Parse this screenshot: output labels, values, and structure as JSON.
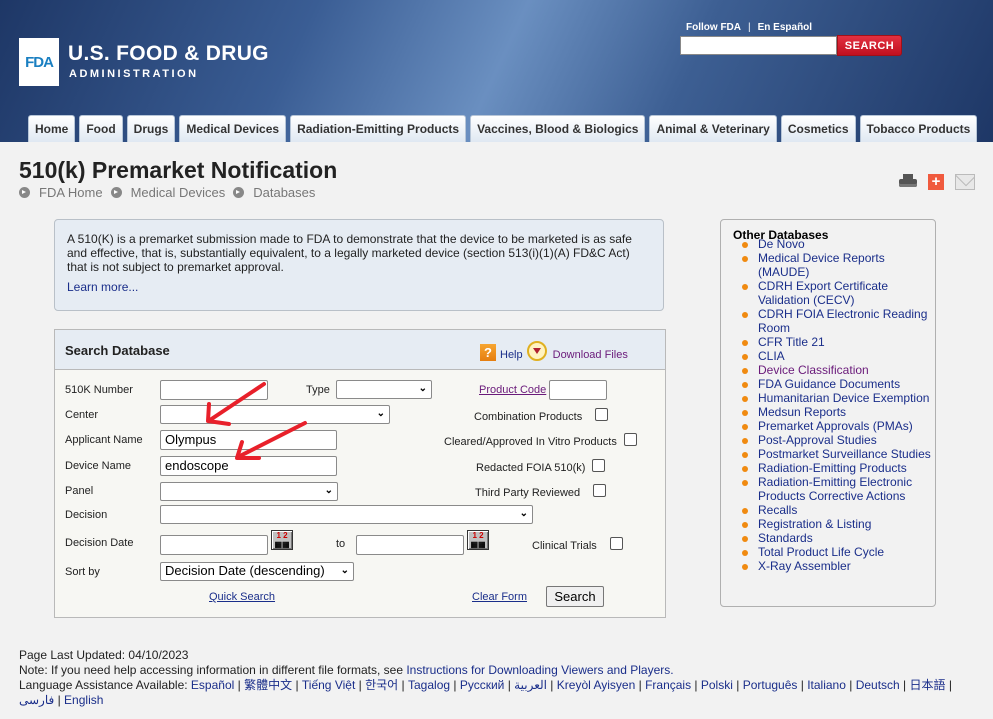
{
  "header": {
    "logo_text": "FDA",
    "agency_line1": "U.S. FOOD & DRUG",
    "agency_line2": "ADMINISTRATION",
    "top_links": [
      "Follow FDA",
      "En Español"
    ],
    "top_links_separator": "|",
    "search_placeholder": "",
    "search_button": "SEARCH",
    "nav_tabs": [
      "Home",
      "Food",
      "Drugs",
      "Medical Devices",
      "Radiation-Emitting Products",
      "Vaccines, Blood & Biologics",
      "Animal & Veterinary",
      "Cosmetics",
      "Tobacco Products"
    ]
  },
  "page": {
    "title": "510(k) Premarket Notification",
    "breadcrumb": [
      "FDA Home",
      "Medical Devices",
      "Databases"
    ],
    "tools": {
      "print_icon": "printer-icon",
      "share_icon": "plus-icon",
      "email_icon": "mail-icon"
    }
  },
  "info": {
    "text": "A 510(K) is a premarket submission made to FDA to demonstrate that the device to be marketed is as safe and effective, that is, substantially equivalent, to a legally marketed device (section 513(i)(1)(A) FD&C Act) that is not subject to premarket approval.",
    "learn_more": "Learn more..."
  },
  "search_panel": {
    "title": "Search Database",
    "help": "Help",
    "download": "Download Files",
    "fields": {
      "k_number": {
        "label": "510K Number",
        "value": ""
      },
      "type": {
        "label": "Type",
        "value": ""
      },
      "product_code": {
        "label": "Product Code",
        "value": ""
      },
      "center": {
        "label": "Center",
        "value": ""
      },
      "applicant": {
        "label": "Applicant Name",
        "value": "Olympus"
      },
      "device": {
        "label": "Device Name",
        "value": "endoscope"
      },
      "panel": {
        "label": "Panel",
        "value": ""
      },
      "decision": {
        "label": "Decision",
        "value": ""
      },
      "decision_date": {
        "label": "Decision Date",
        "from": "",
        "to": "",
        "to_label": "to"
      },
      "sort_by": {
        "label": "Sort by",
        "value": "Decision Date (descending)"
      }
    },
    "checkboxes": {
      "combination": {
        "label": "Combination Products",
        "checked": false
      },
      "in_vitro": {
        "label": "Cleared/Approved In Vitro Products",
        "checked": false
      },
      "redacted": {
        "label": "Redacted FOIA 510(k)",
        "checked": false
      },
      "third_party": {
        "label": "Third Party Reviewed",
        "checked": false
      },
      "clinical": {
        "label": "Clinical Trials",
        "checked": false
      }
    },
    "quick_search": "Quick Search",
    "clear_form": "Clear Form",
    "search_button": "Search",
    "annotation_color": "#e8202a"
  },
  "sidebar": {
    "title": "Other Databases",
    "items": [
      {
        "label": "De Novo",
        "visited": false
      },
      {
        "label": "Medical Device Reports (MAUDE)",
        "visited": false
      },
      {
        "label": "CDRH Export Certificate Validation (CECV)",
        "visited": false
      },
      {
        "label": "CDRH FOIA Electronic Reading Room",
        "visited": false
      },
      {
        "label": "CFR Title 21",
        "visited": false
      },
      {
        "label": "CLIA",
        "visited": false
      },
      {
        "label": "Device Classification",
        "visited": true
      },
      {
        "label": "FDA Guidance Documents",
        "visited": false
      },
      {
        "label": "Humanitarian Device Exemption",
        "visited": false
      },
      {
        "label": "Medsun Reports",
        "visited": false
      },
      {
        "label": "Premarket Approvals (PMAs)",
        "visited": false
      },
      {
        "label": "Post-Approval Studies",
        "visited": false
      },
      {
        "label": "Postmarket Surveillance Studies",
        "visited": false
      },
      {
        "label": "Radiation-Emitting Products",
        "visited": false
      },
      {
        "label": "Radiation-Emitting Electronic Products Corrective Actions",
        "visited": false
      },
      {
        "label": "Recalls",
        "visited": false
      },
      {
        "label": "Registration & Listing",
        "visited": false
      },
      {
        "label": "Standards",
        "visited": false
      },
      {
        "label": "Total Product Life Cycle",
        "visited": false
      },
      {
        "label": "X-Ray Assembler",
        "visited": false
      }
    ]
  },
  "footer": {
    "last_updated": "Page Last Updated: 04/10/2023",
    "note_prefix": "Note: If you need help accessing information in different file formats, see ",
    "note_link": "Instructions for Downloading Viewers and Players.",
    "lang_prefix": "Language Assistance Available: ",
    "languages": [
      "Español",
      "繁體中文",
      "Tiếng Việt",
      "한국어",
      "Tagalog",
      "Русский",
      "العربية",
      "Kreyòl Ayisyen",
      "Français",
      "Polski",
      "Português",
      "Italiano",
      "Deutsch",
      "日本語",
      "فارسی",
      "English"
    ]
  }
}
